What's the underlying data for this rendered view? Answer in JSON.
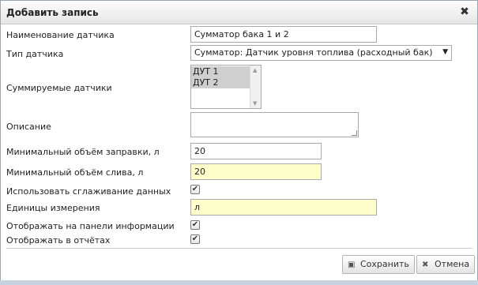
{
  "dialog": {
    "title": "Добавить запись",
    "close_icon": "close-icon"
  },
  "form": {
    "sensor_name": {
      "label": "Наименование датчика",
      "value": "Сумматор бака 1 и 2"
    },
    "sensor_type": {
      "label": "Тип датчика",
      "value": "Сумматор: Датчик уровня топлива (расходный бак)"
    },
    "summed_sensors": {
      "label": "Суммируемые датчики",
      "options": [
        "ДУТ 1",
        "ДУТ 2"
      ]
    },
    "description": {
      "label": "Описание",
      "value": ""
    },
    "min_refuel": {
      "label": "Минимальный объём заправки, л",
      "value": "20"
    },
    "min_drain": {
      "label": "Минимальный объём слива, л",
      "value": "20"
    },
    "smoothing": {
      "label": "Использовать сглаживание данных",
      "checked": true
    },
    "units": {
      "label": "Единицы измерения",
      "value": "л"
    },
    "show_info_panel": {
      "label": "Отображать на панели информации",
      "checked": true
    },
    "show_reports": {
      "label": "Отображать в отчётах",
      "checked": true
    }
  },
  "footer": {
    "save_label": "Сохранить",
    "save_icon": "save-icon",
    "cancel_label": "Отмена",
    "cancel_icon": "cancel-icon"
  },
  "colors": {
    "highlight_field": "#ffffcc",
    "selected_option": "#cfcfcf"
  }
}
